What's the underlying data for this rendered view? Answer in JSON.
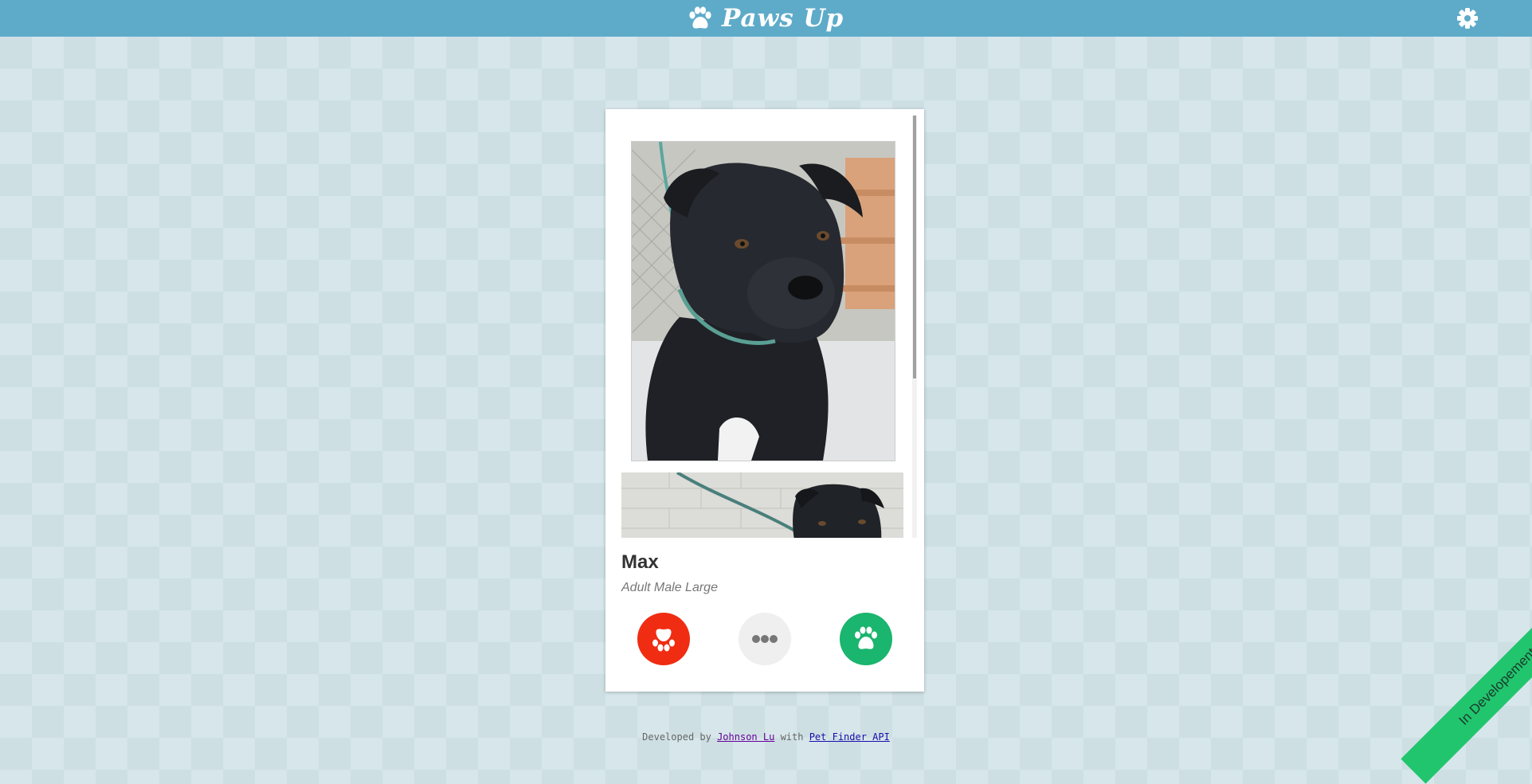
{
  "header": {
    "title": "Paws Up",
    "logo_icon": "paw-icon",
    "settings_icon": "gear-icon"
  },
  "card": {
    "photos": [
      "dog-photo-main",
      "dog-photo-second"
    ],
    "pet_name": "Max",
    "pet_info": "Adult Male Large",
    "actions": {
      "reject_icon": "paw-icon",
      "more_icon": "ellipsis-icon",
      "like_icon": "paw-icon"
    }
  },
  "footer": {
    "prefix": "Developed by",
    "author_link": "Johnson Lu",
    "middle": "with",
    "api_link": "Pet Finder API"
  },
  "ribbon": {
    "label": "In Developement"
  },
  "colors": {
    "header": "#5eabc9",
    "reject": "#f02c12",
    "more": "#efefef",
    "like": "#1ab56e",
    "ribbon": "#21c56e"
  }
}
